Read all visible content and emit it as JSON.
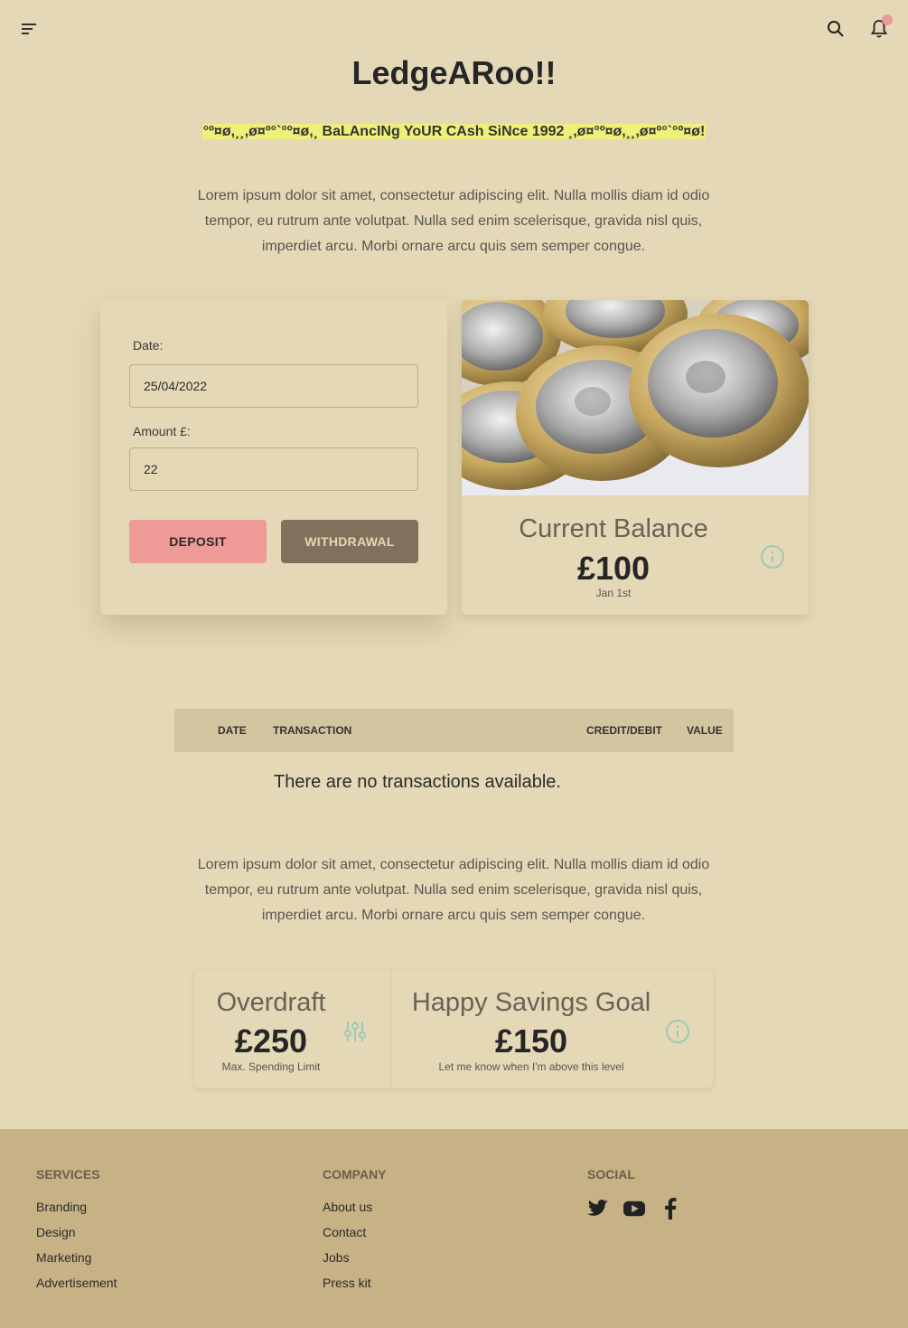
{
  "app": {
    "title": "LedgeARoo!!",
    "tagline": "°º¤ø,¸¸,ø¤º°`°º¤ø,¸ BaLAncINg YoUR CAsh SiNce 1992 ¸,ø¤°º¤ø,¸¸,ø¤º°`°º¤ø!",
    "intro": "Lorem ipsum dolor sit amet, consectetur adipiscing elit. Nulla mollis diam id odio tempor, eu rutrum ante volutpat. Nulla sed enim scelerisque, gravida nisl quis, imperdiet arcu. Morbi ornare arcu quis sem semper congue."
  },
  "topbar": {
    "menu_icon": "menu-icon",
    "search_icon": "search-icon",
    "bell_icon": "bell-icon",
    "notification_color": "#ea9a9a"
  },
  "form": {
    "date_label": "Date:",
    "date_value": "25/04/2022",
    "amount_label": "Amount £:",
    "amount_value": "22",
    "deposit_label": "DEPOSIT",
    "withdraw_label": "WITHDRAWAL"
  },
  "balance": {
    "label": "Current Balance",
    "value": "£100",
    "sub": "Jan 1st",
    "icon": "info-icon"
  },
  "table": {
    "columns": [
      "DATE",
      "TRANSACTION",
      "CREDIT/DEBIT",
      "VALUE"
    ],
    "empty_message": "There are no transactions available."
  },
  "stats": {
    "overdraft": {
      "label": "Overdraft",
      "value": "£250",
      "sub": "Max. Spending Limit",
      "icon": "sliders-icon"
    },
    "savings": {
      "label": "Happy Savings Goal",
      "value": "£150",
      "sub": "Let me know when I'm above this level",
      "icon": "info-icon"
    }
  },
  "footer": {
    "services": {
      "heading": "SERVICES",
      "links": [
        "Branding",
        "Design",
        "Marketing",
        "Advertisement"
      ]
    },
    "company": {
      "heading": "COMPANY",
      "links": [
        "About us",
        "Contact",
        "Jobs",
        "Press kit"
      ]
    },
    "social": {
      "heading": "SOCIAL",
      "icons": [
        "twitter-icon",
        "youtube-icon",
        "facebook-icon"
      ]
    }
  },
  "colors": {
    "background": "#e4d8b6",
    "deposit": "#ee9a97",
    "withdraw": "#7f715b",
    "footer": "#c7b285",
    "info_accent": "#9fc9b8",
    "highlight": "#eef07a"
  }
}
